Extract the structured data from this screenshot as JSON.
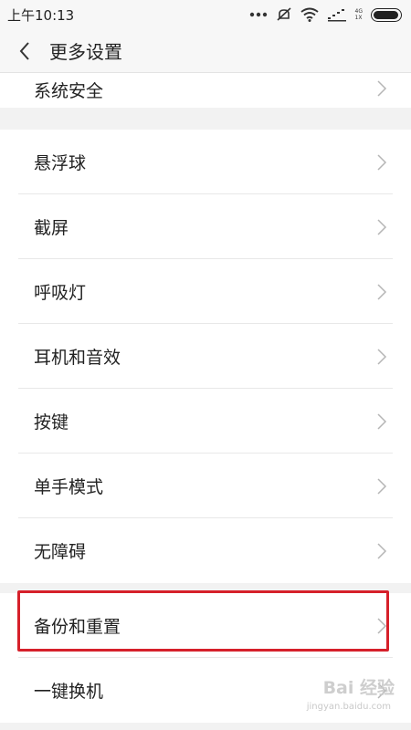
{
  "status_bar": {
    "time": "上午10:13",
    "network_label_top": "4G",
    "network_label_bottom": "1X",
    "battery_level": 0.95
  },
  "header": {
    "title": "更多设置"
  },
  "groups": [
    {
      "items": [
        {
          "label": "系统安全"
        }
      ]
    },
    {
      "items": [
        {
          "label": "悬浮球"
        },
        {
          "label": "截屏"
        },
        {
          "label": "呼吸灯"
        },
        {
          "label": "耳机和音效"
        },
        {
          "label": "按键"
        },
        {
          "label": "单手模式"
        },
        {
          "label": "无障碍"
        }
      ]
    },
    {
      "items": [
        {
          "label": "备份和重置"
        },
        {
          "label": "一键换机"
        }
      ]
    }
  ],
  "watermark": {
    "brand": "Bai 经验",
    "url": "jingyan.baidu.com"
  },
  "colors": {
    "highlight": "#d6202a",
    "background": "#f2f2f2"
  }
}
